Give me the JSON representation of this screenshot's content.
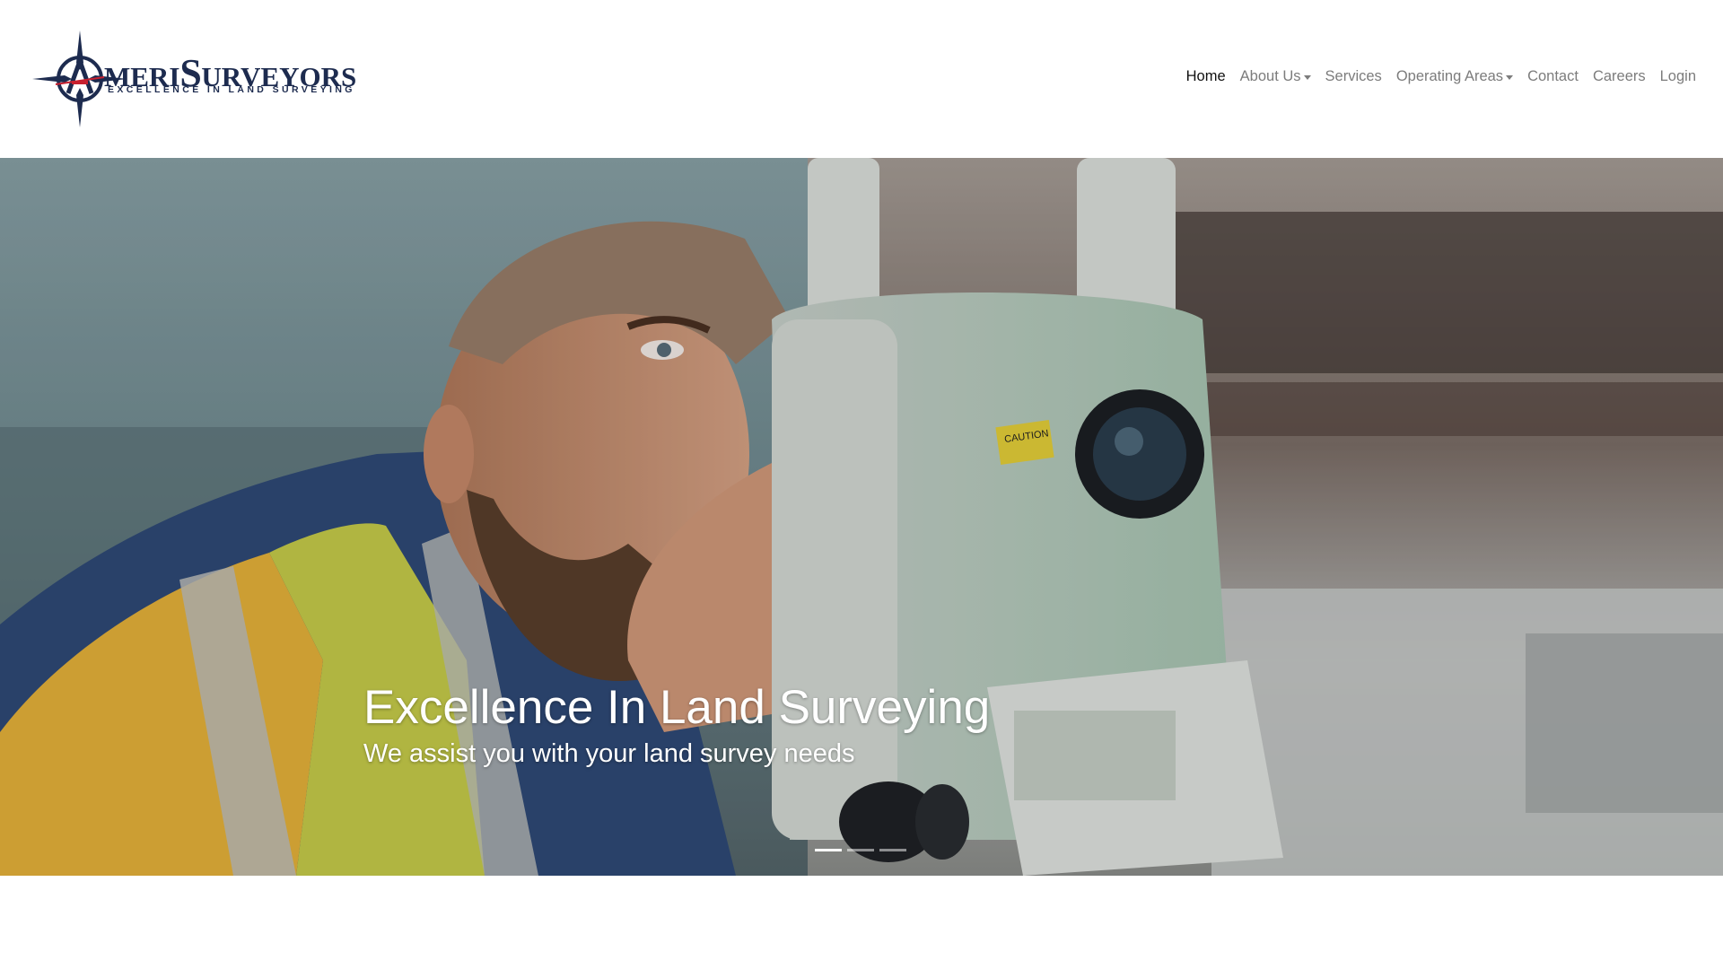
{
  "brand": {
    "logo_big_a": "A",
    "logo_meri": "MERI",
    "logo_s": "S",
    "logo_urveyor": "URVEYORS",
    "tagline": "EXCELLENCE IN LAND SURVEYING",
    "color": "#1d2b4f",
    "accent": "#c8202f"
  },
  "nav": {
    "items": [
      {
        "label": "Home",
        "active": true
      },
      {
        "label": "About Us",
        "dropdown": true
      },
      {
        "label": "Services"
      },
      {
        "label": "Operating Areas",
        "dropdown": true
      },
      {
        "label": "Contact"
      },
      {
        "label": "Careers"
      },
      {
        "label": "Login"
      }
    ]
  },
  "hero": {
    "title": "Excellence In Land Surveying",
    "subtitle": "We assist you with your land survey needs",
    "slide_count": 3,
    "active_slide": 1,
    "photo_icon": "surveyor-with-total-station",
    "instrument_label": "CAUTION"
  }
}
